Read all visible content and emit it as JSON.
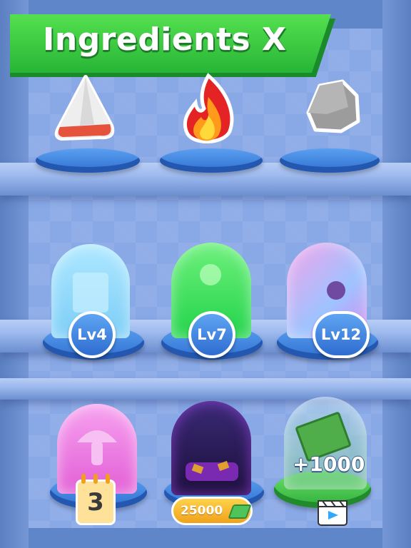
{
  "header": {
    "title": "Ingredients X"
  },
  "shelf_top": {
    "items": [
      {
        "name": "shark-tooth-ingredient"
      },
      {
        "name": "fire-ingredient"
      },
      {
        "name": "rock-ingredient"
      }
    ]
  },
  "shelf_middle": {
    "items": [
      {
        "level": "Lv4",
        "color": "#8fd9ff"
      },
      {
        "level": "Lv7",
        "color": "#3ee05a"
      },
      {
        "level": "Lv12",
        "color": "#c27cf0"
      }
    ]
  },
  "shelf_bottom": {
    "items": [
      {
        "days": "3",
        "color": "#f07ee6"
      },
      {
        "price": "25000",
        "color": "#3a1e6e"
      },
      {
        "reward": "+1000",
        "color": "#5cc65a"
      }
    ]
  },
  "colors": {
    "banner": "#3ec94a",
    "pedestal": "#3f82e0"
  }
}
